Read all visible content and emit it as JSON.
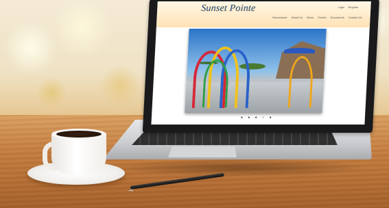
{
  "website": {
    "logo_text": "Sunset Pointe",
    "auth_links": [
      "Login",
      "Register"
    ],
    "nav_items": [
      "Homeowner",
      "About Us",
      "News",
      "Events",
      "Documents",
      "Contact Us"
    ],
    "pager": "● ● ● ○ ●"
  },
  "colors": {
    "logo": "#1f4f8f",
    "header_bg": "#ffe2b4",
    "table_wood": "#c37d40",
    "pool_sky": "#2b74c8"
  }
}
